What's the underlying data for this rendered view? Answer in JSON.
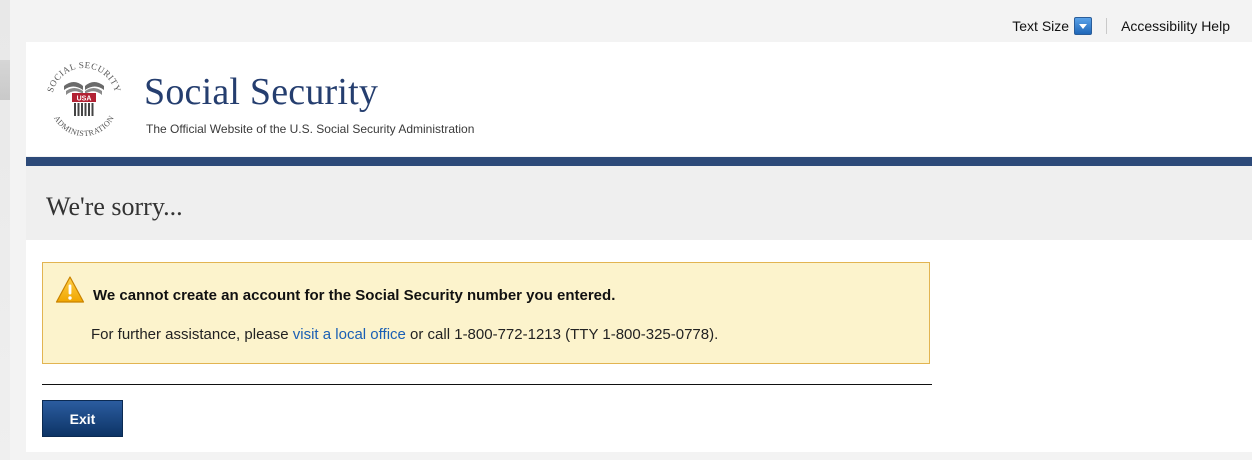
{
  "utility": {
    "text_size_label": "Text Size",
    "accessibility_help": "Accessibility Help"
  },
  "header": {
    "title": "Social Security",
    "subtitle": "The Official Website of the U.S. Social Security Administration",
    "seal": {
      "top_text": "SOCIAL SECURITY",
      "bottom_text": "ADMINISTRATION",
      "center_text": "USA"
    }
  },
  "page": {
    "heading": "We're sorry..."
  },
  "alert": {
    "title": "We cannot create an account for the Social Security number you entered.",
    "body_prefix": "For further assistance, please ",
    "link_text": "visit a local office",
    "body_suffix": " or call 1-800-772-1213 (TTY 1-800-325-0778)."
  },
  "actions": {
    "exit_label": "Exit"
  },
  "colors": {
    "brand_navy": "#2d4a79",
    "title_blue": "#253e6f",
    "alert_bg": "#fcf3cc",
    "alert_border": "#e2b451",
    "link": "#1a5fb4",
    "button": "#0d3466"
  },
  "icons": {
    "text_size": "chevron-down-icon",
    "alert": "warning-icon",
    "seal": "ssa-seal-icon"
  }
}
